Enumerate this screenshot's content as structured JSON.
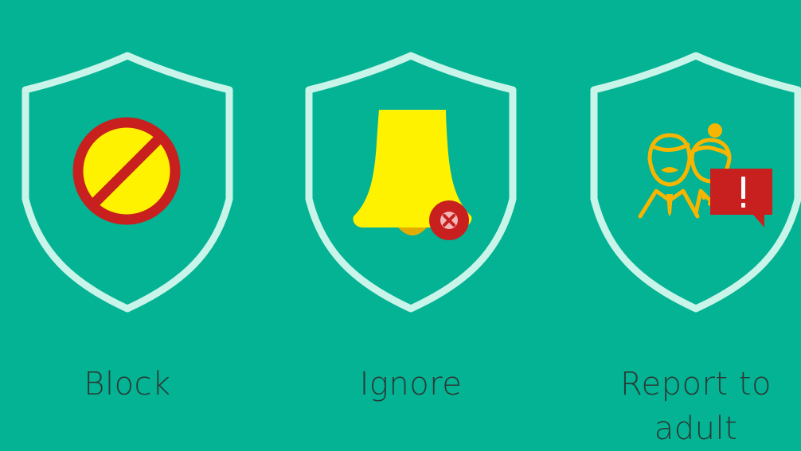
{
  "options": [
    {
      "id": "block",
      "label": "Block",
      "icon": "block-icon"
    },
    {
      "id": "ignore",
      "label": "Ignore",
      "icon": "muted-bell-icon"
    },
    {
      "id": "report",
      "label": "Report to\nadult",
      "icon": "report-adult-icon"
    }
  ],
  "colors": {
    "background": "#03b393",
    "shield_outline": "#c9f4ea",
    "label_text": "#2a3a36",
    "icon_yellow": "#fff200",
    "icon_red": "#c8201f",
    "people_orange": "#f7b500"
  }
}
